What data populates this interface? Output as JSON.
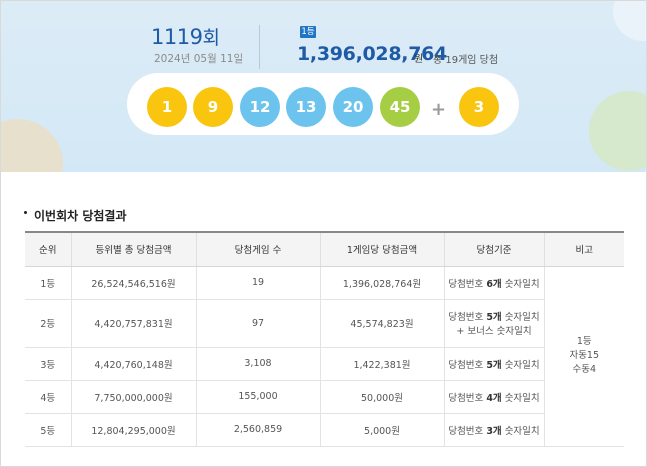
{
  "header": {
    "round_number": "1119",
    "round_suffix": "회",
    "draw_date": "2024년 05월 11일",
    "rank_badge": "1등",
    "first_prize_amount": "1,396,028,764",
    "won_unit": "원",
    "winners_text": "총 19게임 당첨"
  },
  "numbers": {
    "main": [
      {
        "value": "1",
        "color": "#f9c50f"
      },
      {
        "value": "9",
        "color": "#f9c50f"
      },
      {
        "value": "12",
        "color": "#6cc4ee"
      },
      {
        "value": "13",
        "color": "#6cc4ee"
      },
      {
        "value": "20",
        "color": "#6cc4ee"
      },
      {
        "value": "45",
        "color": "#a5ce45"
      }
    ],
    "plus": "+",
    "bonus": {
      "value": "3",
      "color": "#f9c50f"
    }
  },
  "results": {
    "title": "이번회차 당첨결과",
    "columns": [
      "순위",
      "등위별 총 당첨금액",
      "당첨게임 수",
      "1게임당 당첨금액",
      "당첨기준",
      "비고"
    ],
    "rows": [
      {
        "rank": "1등",
        "total": "26,524,546,516원",
        "games": "19",
        "per_game": "1,396,028,764원",
        "criteria_pre": "당첨번호 ",
        "criteria_bold": "6개",
        "criteria_post": " 숫자일치",
        "criteria_line2": ""
      },
      {
        "rank": "2등",
        "total": "4,420,757,831원",
        "games": "97",
        "per_game": "45,574,823원",
        "criteria_pre": "당첨번호 ",
        "criteria_bold": "5개",
        "criteria_post": " 숫자일치",
        "criteria_line2": "+ 보너스 숫자일치"
      },
      {
        "rank": "3등",
        "total": "4,420,760,148원",
        "games": "3,108",
        "per_game": "1,422,381원",
        "criteria_pre": "당첨번호 ",
        "criteria_bold": "5개",
        "criteria_post": " 숫자일치",
        "criteria_line2": ""
      },
      {
        "rank": "4등",
        "total": "7,750,000,000원",
        "games": "155,000",
        "per_game": "50,000원",
        "criteria_pre": "당첨번호 ",
        "criteria_bold": "4개",
        "criteria_post": " 숫자일치",
        "criteria_line2": ""
      },
      {
        "rank": "5등",
        "total": "12,804,295,000원",
        "games": "2,560,859",
        "per_game": "5,000원",
        "criteria_pre": "당첨번호 ",
        "criteria_bold": "3개",
        "criteria_post": " 숫자일치",
        "criteria_line2": ""
      }
    ],
    "note": {
      "line1": "1등",
      "line2": "자동15",
      "line3": "수동4"
    }
  }
}
